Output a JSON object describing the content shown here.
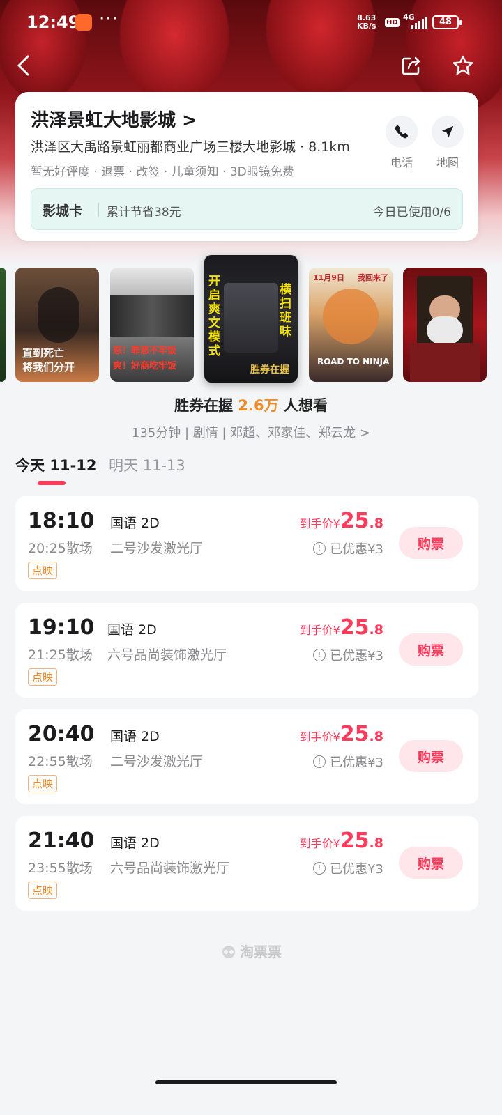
{
  "status_bar": {
    "time": "12:49",
    "dots": "···",
    "speed_top": "8.63",
    "speed_bottom": "KB/s",
    "hd": "HD",
    "network": "4G",
    "battery": "48"
  },
  "nav": {
    "back_icon": "chevron-left-icon",
    "share_icon": "share-icon",
    "favorite_icon": "star-icon"
  },
  "cinema": {
    "name": "洪泽景虹大地影城 >",
    "address": "洪泽区大禹路景虹丽都商业广场三楼大地影城 · 8.1km",
    "tags": "暂无好评度 · 退票 · 改签 · 儿童须知 · 3D眼镜免费",
    "phone_label": "电话",
    "map_label": "地图",
    "card": {
      "title": "影城卡",
      "savings": "累计节省38元",
      "usage": "今日已使用0/6"
    }
  },
  "posters": [
    {
      "id": "edge-left",
      "lines": []
    },
    {
      "id": "venom",
      "lines": [
        "直到死亡",
        "将我们分开"
      ]
    },
    {
      "id": "anger",
      "lines": [
        "怒！罪恶不牢饭",
        "爽！好商吃牢饭"
      ]
    },
    {
      "id": "selected",
      "lines": [
        "开启爽文模式",
        "横扫班味",
        "胜券在握"
      ]
    },
    {
      "id": "naruto",
      "lines": [
        "11月9日",
        "我回来了",
        "ROAD TO NINJA"
      ]
    },
    {
      "id": "santa",
      "lines": []
    }
  ],
  "movie": {
    "title_prefix": "胜券在握 ",
    "want_count": "2.6万",
    "title_suffix": " 人想看",
    "meta": "135分钟 | 剧情 | 邓超、邓家佳、郑云龙 >"
  },
  "date_tabs": [
    {
      "label": "今天 11-12",
      "active": true
    },
    {
      "label": "明天 11-13",
      "active": false
    }
  ],
  "showtimes": [
    {
      "start": "18:10",
      "end": "20:25散场",
      "lang": "国语 2D",
      "hall": "二号沙发激光厅",
      "badge": "点映",
      "price_label": "到手价¥",
      "price_int": "25",
      "price_dec": ".8",
      "discount": "已优惠¥3",
      "buy": "购票"
    },
    {
      "start": "19:10",
      "end": "21:25散场",
      "lang": "国语 2D",
      "hall": "六号品尚装饰激光厅",
      "badge": "点映",
      "price_label": "到手价¥",
      "price_int": "25",
      "price_dec": ".8",
      "discount": "已优惠¥3",
      "buy": "购票"
    },
    {
      "start": "20:40",
      "end": "22:55散场",
      "lang": "国语 2D",
      "hall": "二号沙发激光厅",
      "badge": "点映",
      "price_label": "到手价¥",
      "price_int": "25",
      "price_dec": ".8",
      "discount": "已优惠¥3",
      "buy": "购票"
    },
    {
      "start": "21:40",
      "end": "23:55散场",
      "lang": "国语 2D",
      "hall": "六号品尚装饰激光厅",
      "badge": "点映",
      "price_label": "到手价¥",
      "price_int": "25",
      "price_dec": ".8",
      "discount": "已优惠¥3",
      "buy": "购票"
    }
  ],
  "footer": {
    "logo": "淘票票"
  },
  "colors": {
    "accent": "#ff3b5c",
    "orange": "#f08a24",
    "card_band": "#e6f6f3"
  }
}
